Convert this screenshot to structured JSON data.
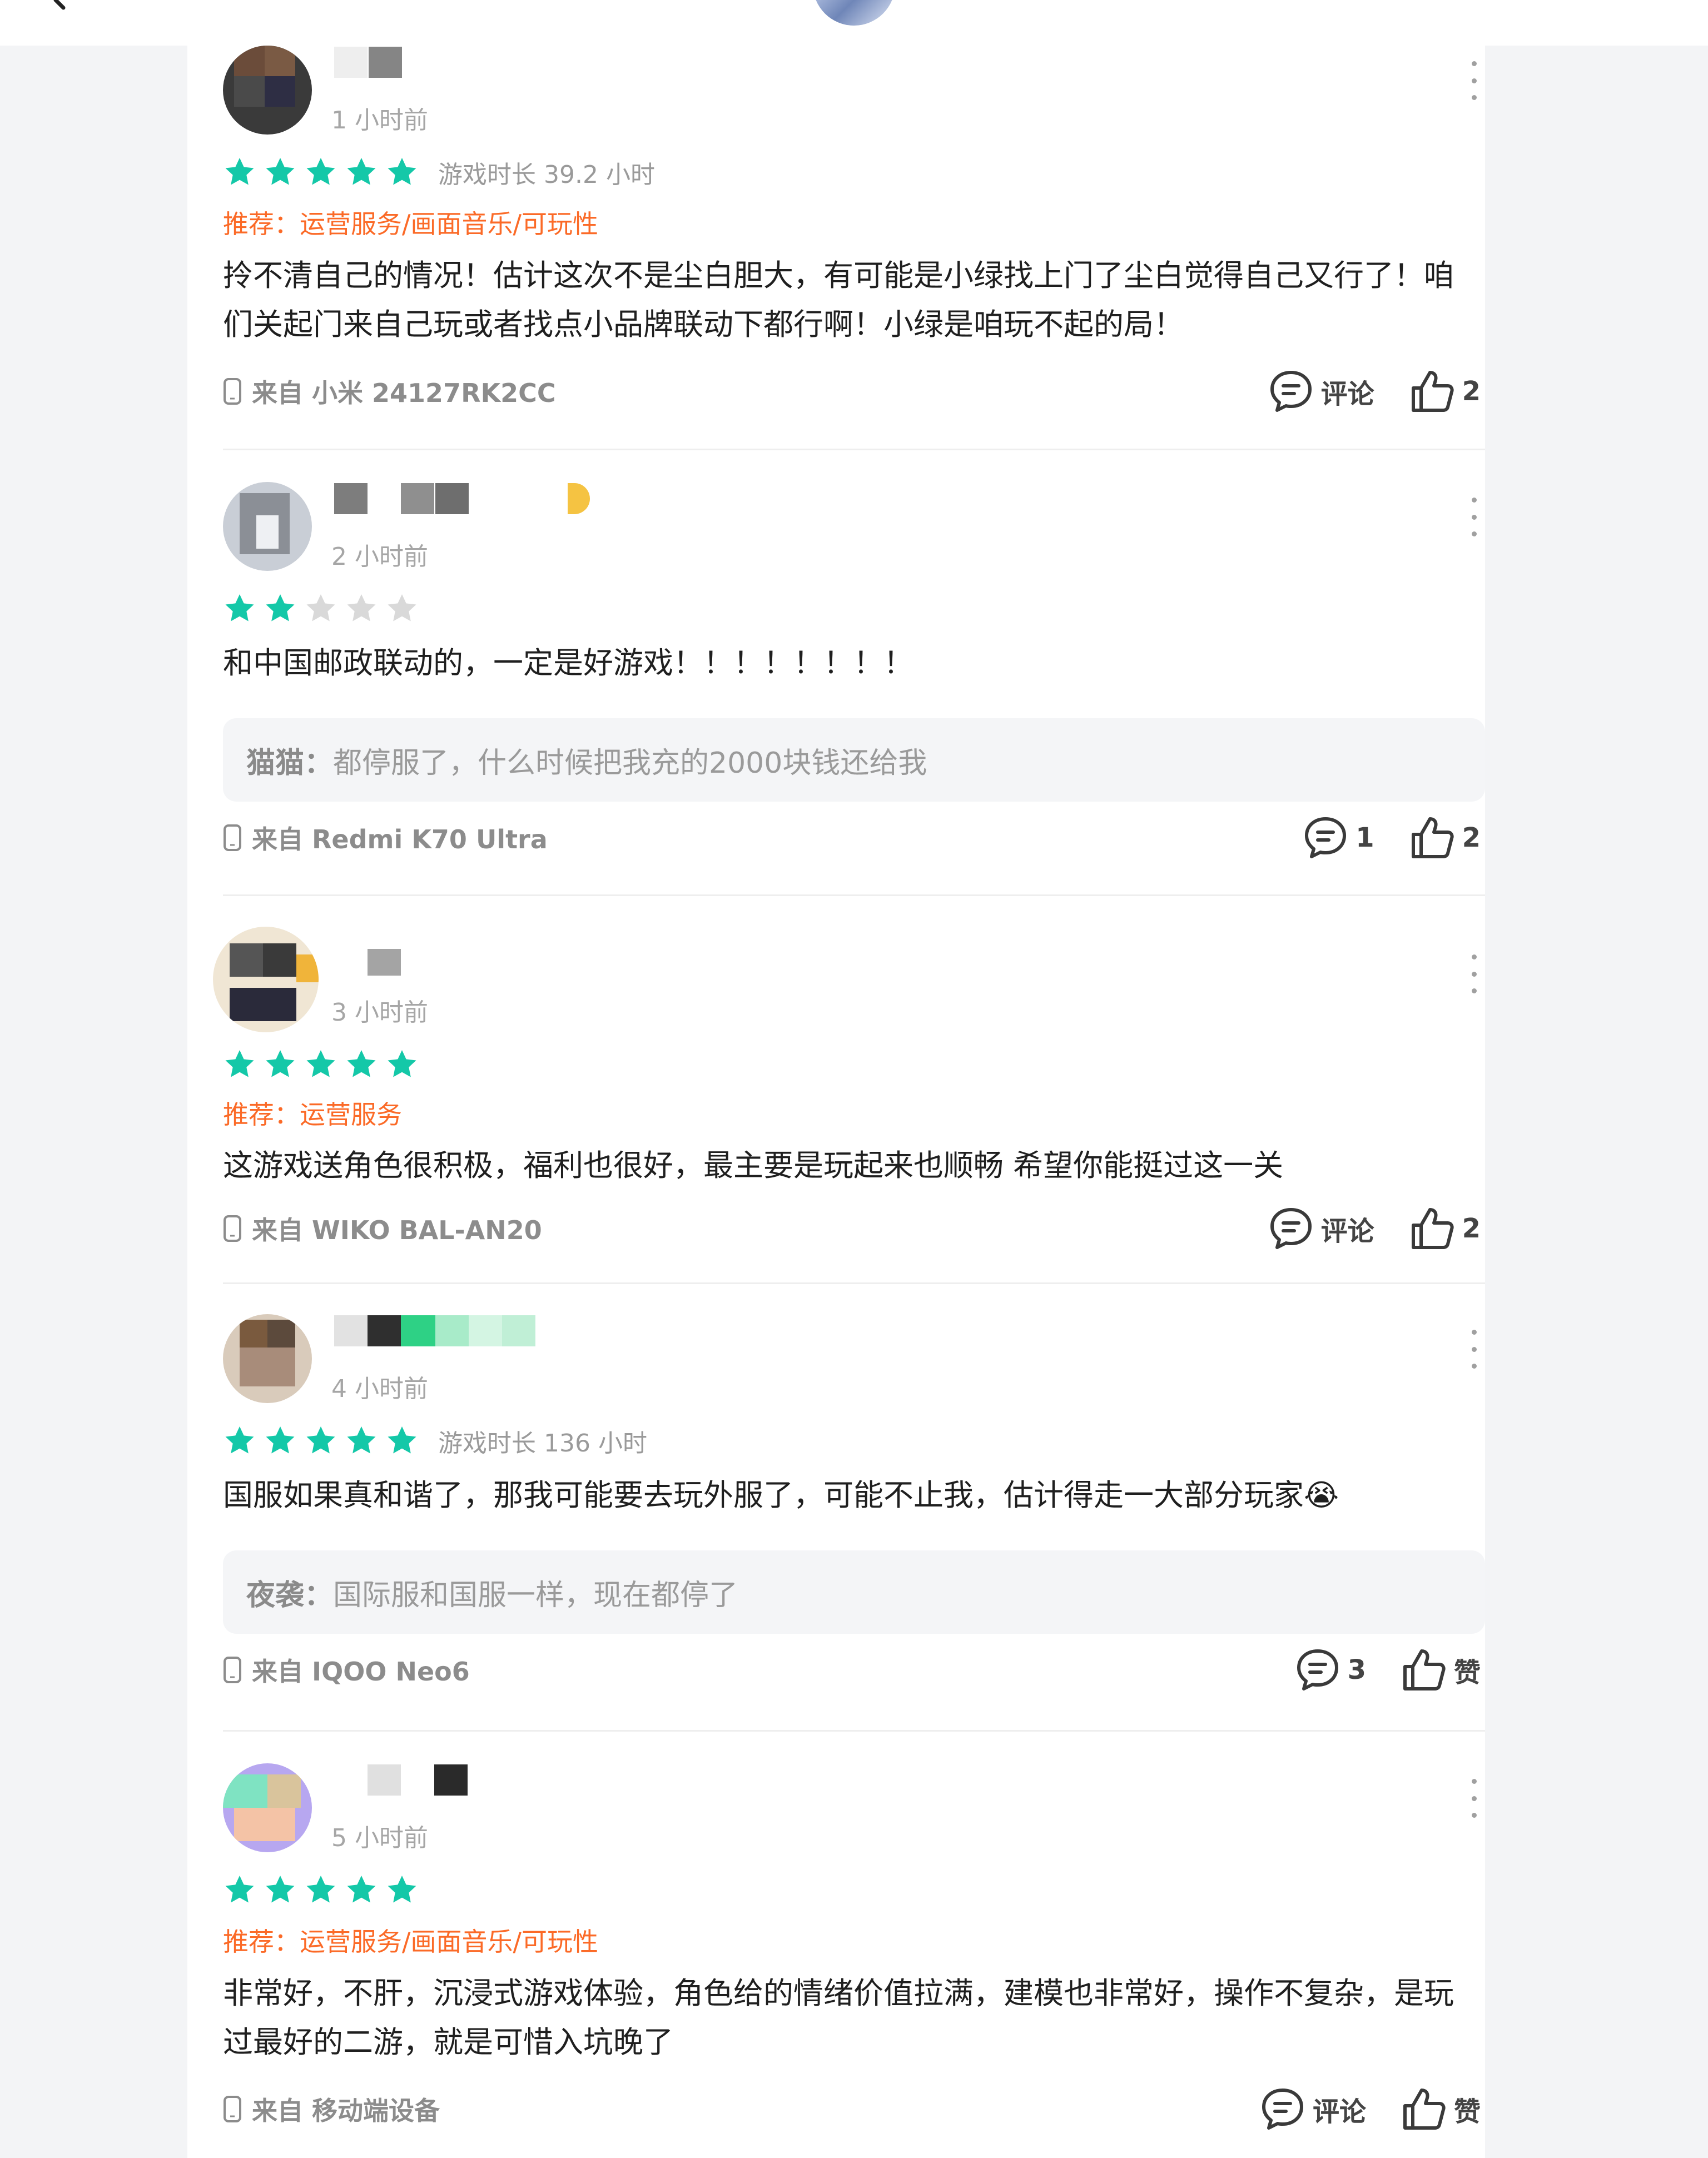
{
  "reviews": [
    {
      "time": "1 小时前",
      "rating": 5,
      "playtime": "游戏时长 39.2 小时",
      "recommend": "推荐：运营服务/画面音乐/可玩性",
      "content": "拎不清自己的情况！估计这次不是尘白胆大，有可能是小绿找上门了尘白觉得自己又行了！咱们关起门来自己玩或者找点小品牌联动下都行啊！小绿是咱玩不起的局！",
      "reply": null,
      "device": "来自 小米 24127RK2CC",
      "comment_label": "评论",
      "like_label": "2"
    },
    {
      "time": "2 小时前",
      "rating": 2,
      "playtime": "",
      "recommend": "",
      "content": "和中国邮政联动的，一定是好游戏！！！！！！！！",
      "reply": {
        "user": "猫猫：",
        "text": "都停服了，什么时候把我充的2000块钱还给我"
      },
      "device": "来自 Redmi K70 Ultra",
      "comment_label": "1",
      "like_label": "2"
    },
    {
      "time": "3 小时前",
      "rating": 5,
      "playtime": "",
      "recommend": "推荐：运营服务",
      "content": "这游戏送角色很积极，福利也很好，最主要是玩起来也顺畅 希望你能挺过这一关",
      "reply": null,
      "device": "来自 WIKO BAL-AN20",
      "comment_label": "评论",
      "like_label": "2"
    },
    {
      "time": "4 小时前",
      "rating": 5,
      "playtime": "游戏时长 136 小时",
      "recommend": "",
      "content": "国服如果真和谐了，那我可能要去玩外服了，可能不止我，估计得走一大部分玩家😭",
      "reply": {
        "user": "夜袭：",
        "text": "国际服和国服一样，现在都停了"
      },
      "device": "来自 IQOO Neo6",
      "comment_label": "3",
      "like_label": "赞"
    },
    {
      "time": "5 小时前",
      "rating": 5,
      "playtime": "",
      "recommend": "推荐：运营服务/画面音乐/可玩性",
      "content": "非常好，不肝，沉浸式游戏体验，角色给的情绪价值拉满，建模也非常好，操作不复杂，是玩过最好的二游，就是可惜入坑晚了",
      "reply": null,
      "device": "来自 移动端设备",
      "comment_label": "评论",
      "like_label": "赞"
    }
  ],
  "colors": {
    "star_on": "#14c8a8",
    "star_off": "#d9d9d9",
    "recommend": "#fb6a27"
  },
  "icons": [
    "back-icon",
    "more-icon",
    "star-icon",
    "phone-icon",
    "comment-icon",
    "thumbs-up-icon"
  ]
}
